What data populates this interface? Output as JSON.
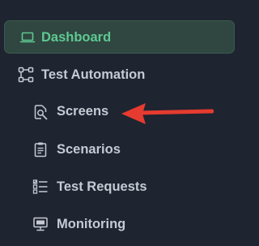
{
  "colors": {
    "background": "#1e2430",
    "active_bg": "#2f4740",
    "active_text": "#5fc892",
    "text": "#c5cad4",
    "icon": "#c5cad4",
    "annotation_arrow": "#e53b30"
  },
  "sidebar": {
    "items": [
      {
        "label": "Dashboard",
        "icon": "laptop-icon",
        "active": true
      },
      {
        "label": "Test Automation",
        "icon": "workflow-icon"
      },
      {
        "label": "Screens",
        "icon": "screen-search-icon"
      },
      {
        "label": "Scenarios",
        "icon": "clipboard-icon"
      },
      {
        "label": "Test Requests",
        "icon": "checklist-icon"
      },
      {
        "label": "Monitoring",
        "icon": "monitor-icon"
      }
    ]
  }
}
